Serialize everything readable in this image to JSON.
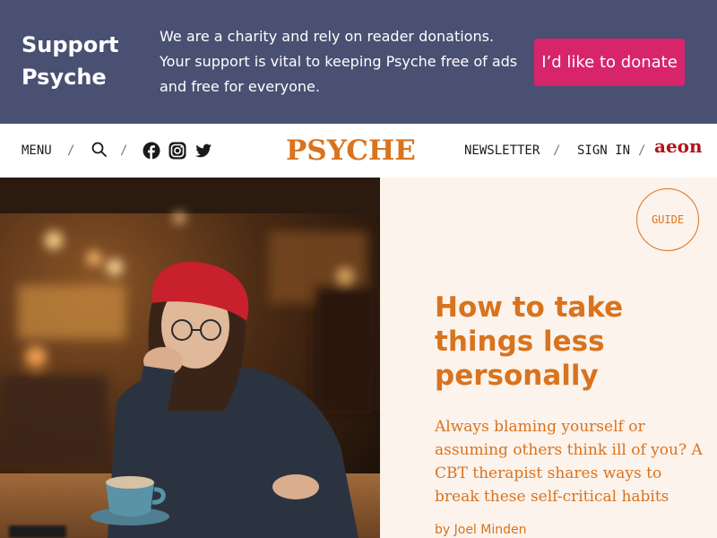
{
  "banner": {
    "title": "Support Psyche",
    "text": "We are a charity and rely on reader donations. Your support is vital to keeping Psyche free of ads and free for everyone.",
    "donate_label": "I’d like to donate"
  },
  "nav": {
    "menu_label": "MENU",
    "separator": "/",
    "logo": "PSYCHE",
    "newsletter_label": "NEWSLETTER",
    "signin_label": "SIGN IN",
    "partner_logo": "aeon",
    "icons": [
      "search-icon",
      "facebook-icon",
      "instagram-icon",
      "twitter-icon"
    ]
  },
  "article": {
    "badge": "GUIDE",
    "title": "How to take things less personally",
    "standfirst": "Always blaming yourself or assuming others think ill of you? A CBT therapist shares ways to break these self-critical habits",
    "byline_prefix": "by",
    "author": "Joel Minden"
  },
  "colors": {
    "banner_bg": "#4a5072",
    "donate_button": "#d8246b",
    "brand_orange": "#d9731d",
    "panel_bg": "#fcf3ed",
    "aeon_red": "#b1141c"
  }
}
